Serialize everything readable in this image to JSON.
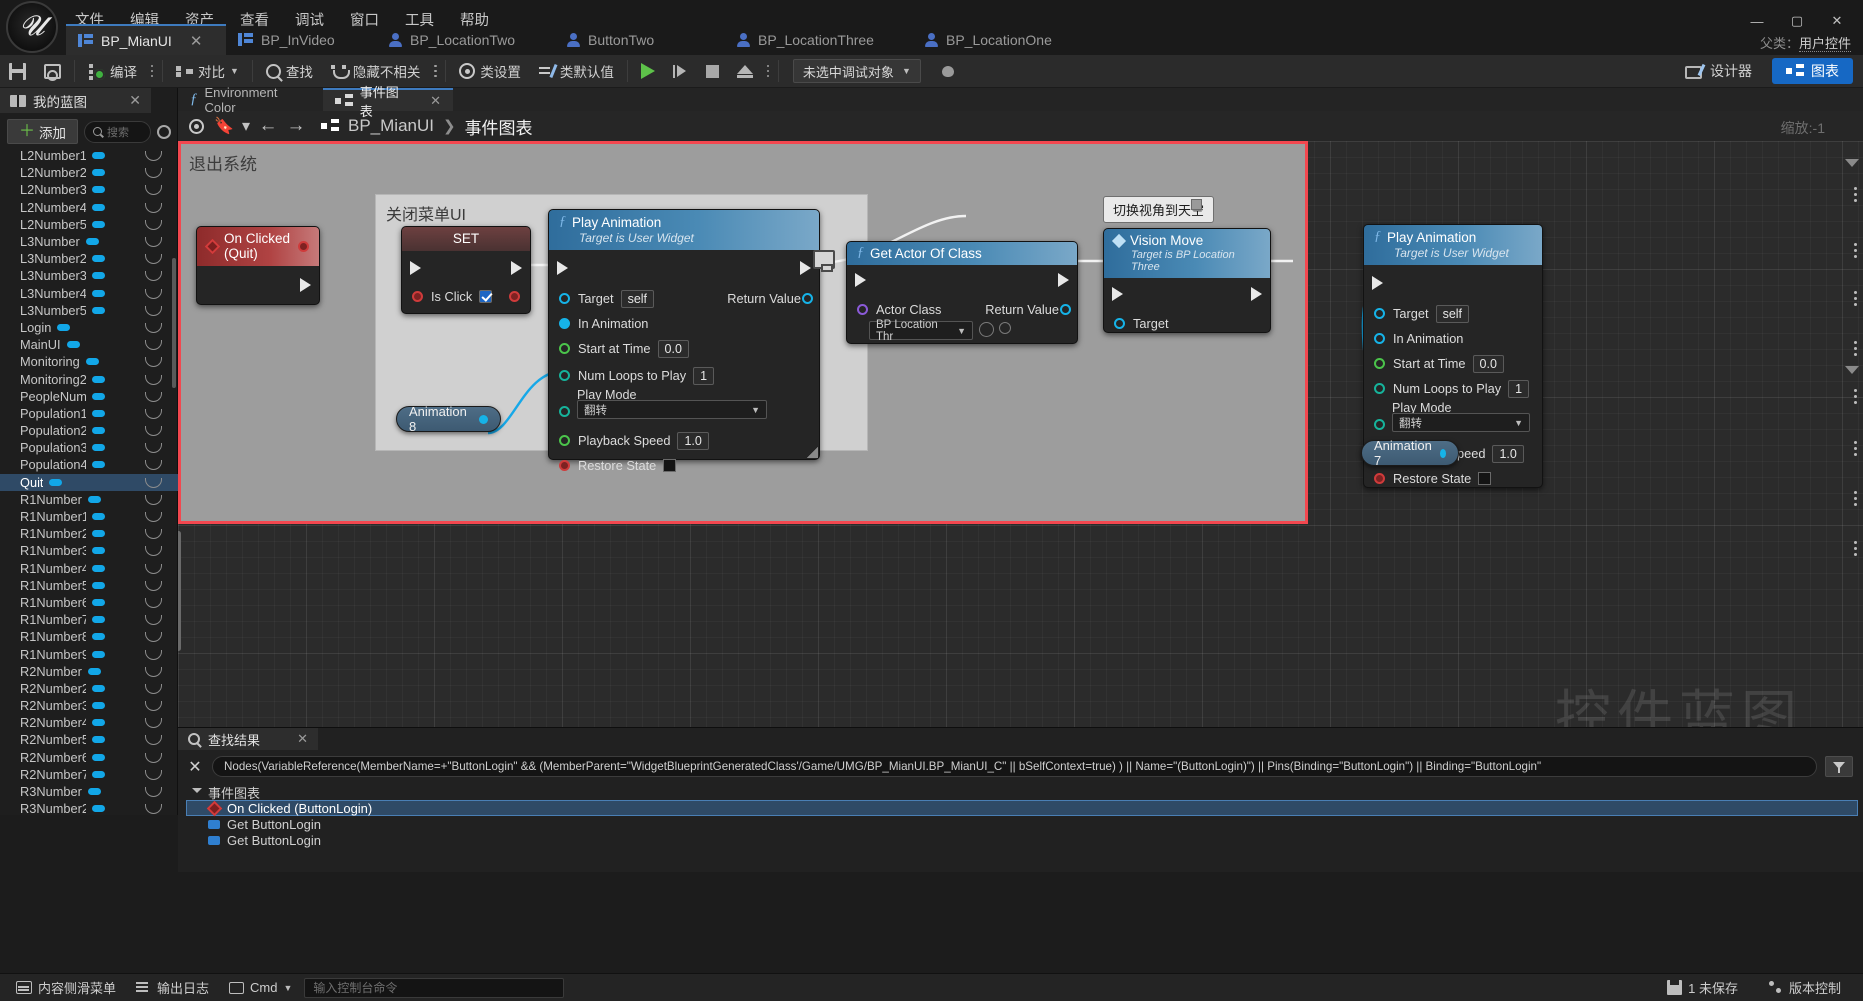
{
  "window": {
    "menu": [
      "文件",
      "编辑",
      "资产",
      "查看",
      "调试",
      "窗口",
      "工具",
      "帮助"
    ],
    "controls": {
      "minimize": "—",
      "maximize": "▢",
      "close": "✕"
    },
    "parent_class_label": "父类：",
    "parent_class_value": "用户控件"
  },
  "asset_tabs": [
    {
      "label": "BP_MianUI",
      "icon": "widget-blueprint-icon",
      "active": true,
      "closable": true
    },
    {
      "label": "BP_InVideo",
      "icon": "widget-blueprint-icon",
      "active": false,
      "closable": false
    },
    {
      "label": "BP_LocationTwo",
      "icon": "actor-blueprint-icon",
      "active": false,
      "closable": false
    },
    {
      "label": "ButtonTwo",
      "icon": "actor-blueprint-icon",
      "active": false,
      "closable": false
    },
    {
      "label": "BP_LocationThree",
      "icon": "actor-blueprint-icon",
      "active": false,
      "closable": false
    },
    {
      "label": "BP_LocationOne",
      "icon": "actor-blueprint-icon",
      "active": false,
      "closable": false
    }
  ],
  "toolbar": {
    "save_label": "",
    "browse_label": "",
    "compile_label": "编译",
    "diff_label": "对比",
    "find_label": "查找",
    "hide_unrelated_label": "隐藏不相关",
    "class_settings_label": "类设置",
    "class_defaults_label": "类默认值",
    "debug_object_value": "未选中调试对象",
    "designer_label": "设计器",
    "graph_label": "图表"
  },
  "left_panel": {
    "tab_label": "我的蓝图",
    "add_label": "添加",
    "search_placeholder": "搜索",
    "variables": [
      {
        "name": "L2Number1",
        "selected": false
      },
      {
        "name": "L2Number2",
        "selected": false
      },
      {
        "name": "L2Number3",
        "selected": false
      },
      {
        "name": "L2Number4",
        "selected": false
      },
      {
        "name": "L2Number5",
        "selected": false
      },
      {
        "name": "L3Number",
        "selected": false
      },
      {
        "name": "L3Number2",
        "selected": false
      },
      {
        "name": "L3Number3",
        "selected": false
      },
      {
        "name": "L3Number4",
        "selected": false
      },
      {
        "name": "L3Number5",
        "selected": false
      },
      {
        "name": "Login",
        "selected": false
      },
      {
        "name": "MainUI",
        "selected": false
      },
      {
        "name": "Monitoring",
        "selected": false
      },
      {
        "name": "Monitoring2",
        "selected": false
      },
      {
        "name": "PeopleNum",
        "selected": false
      },
      {
        "name": "Population1",
        "selected": false
      },
      {
        "name": "Population2",
        "selected": false
      },
      {
        "name": "Population3",
        "selected": false
      },
      {
        "name": "Population4",
        "selected": false
      },
      {
        "name": "Quit",
        "selected": true
      },
      {
        "name": "R1Number",
        "selected": false
      },
      {
        "name": "R1Number1",
        "selected": false
      },
      {
        "name": "R1Number2",
        "selected": false
      },
      {
        "name": "R1Number3",
        "selected": false
      },
      {
        "name": "R1Number4",
        "selected": false
      },
      {
        "name": "R1Number5",
        "selected": false
      },
      {
        "name": "R1Number6",
        "selected": false
      },
      {
        "name": "R1Number7",
        "selected": false
      },
      {
        "name": "R1Number8",
        "selected": false
      },
      {
        "name": "R1Number9",
        "selected": false
      },
      {
        "name": "R2Number",
        "selected": false
      },
      {
        "name": "R2Number2",
        "selected": false
      },
      {
        "name": "R2Number3",
        "selected": false
      },
      {
        "name": "R2Number4",
        "selected": false
      },
      {
        "name": "R2Number5",
        "selected": false
      },
      {
        "name": "R2Number6",
        "selected": false
      },
      {
        "name": "R2Number7",
        "selected": false
      },
      {
        "name": "R3Number",
        "selected": false
      },
      {
        "name": "R3Number2",
        "selected": false
      }
    ]
  },
  "graph": {
    "tabs": [
      {
        "label": "Environment Color",
        "icon": "function-icon",
        "active": false
      },
      {
        "label": "事件图表",
        "icon": "event-graph-icon",
        "active": true
      }
    ],
    "breadcrumb": {
      "root": "BP_MianUI",
      "separator": "❯",
      "current": "事件图表"
    },
    "zoom_label": "缩放:-1",
    "watermark": "控件蓝图",
    "comment_outer": "退出系统",
    "comment_inner": "关闭菜单UI",
    "tooltip": "切换视角到天空",
    "nodes": {
      "on_clicked_quit": {
        "title": "On Clicked (Quit)"
      },
      "set_node": {
        "title": "SET",
        "pin_label": "Is Click",
        "checkbox_checked": true
      },
      "animation8": {
        "title": "Animation 8"
      },
      "animation7": {
        "title": "Animation 7"
      },
      "play_animation_left": {
        "title": "Play Animation",
        "subtitle": "Target is User Widget",
        "target_label": "Target",
        "target_value": "self",
        "return_label": "Return Value",
        "in_animation_label": "In Animation",
        "start_at_time_label": "Start at Time",
        "start_at_time_value": "0.0",
        "num_loops_label": "Num Loops to Play",
        "num_loops_value": "1",
        "play_mode_label": "Play Mode",
        "play_mode_value": "翻转",
        "playback_speed_label": "Playback Speed",
        "playback_speed_value": "1.0",
        "restore_state_label": "Restore State"
      },
      "get_actor_of_class": {
        "title": "Get Actor Of Class",
        "actor_class_label": "Actor Class",
        "actor_class_value": "BP Location Thr",
        "return_label": "Return Value"
      },
      "vision_move": {
        "title": "Vision Move",
        "subtitle": "Target is BP Location Three",
        "target_label": "Target"
      },
      "play_animation_right": {
        "title": "Play Animation",
        "subtitle": "Target is User Widget",
        "target_label": "Target",
        "target_value": "self",
        "in_animation_label": "In Animation",
        "start_at_time_label": "Start at Time",
        "start_at_time_value": "0.0",
        "num_loops_label": "Num Loops to Play",
        "num_loops_value": "1",
        "play_mode_label": "Play Mode",
        "play_mode_value": "翻转",
        "playback_speed_label": "Playback Speed",
        "playback_speed_value": "1.0",
        "restore_state_label": "Restore State"
      }
    }
  },
  "find_results": {
    "tab_label": "查找结果",
    "query": "Nodes(VariableReference(MemberName=+\"ButtonLogin\" && (MemberParent=\"WidgetBlueprintGeneratedClass'/Game/UMG/BP_MianUI.BP_MianUI_C\" || bSelfContext=true) ) || Name=\"(ButtonLogin)\") || Pins(Binding=\"ButtonLogin\") || Binding=\"ButtonLogin\"",
    "tree": {
      "root": "事件图表",
      "children": [
        {
          "label": "On Clicked (ButtonLogin)",
          "type": "event",
          "highlighted": true
        },
        {
          "label": "Get ButtonLogin",
          "type": "variable",
          "highlighted": false
        },
        {
          "label": "Get ButtonLogin",
          "type": "variable",
          "highlighted": false
        }
      ]
    }
  },
  "status_bar": {
    "content_drawer_label": "内容侧滑菜单",
    "output_log_label": "输出日志",
    "cmd_label": "Cmd",
    "console_placeholder": "输入控制台命令",
    "unsaved_label": "1 未保存",
    "source_control_label": "版本控制"
  }
}
